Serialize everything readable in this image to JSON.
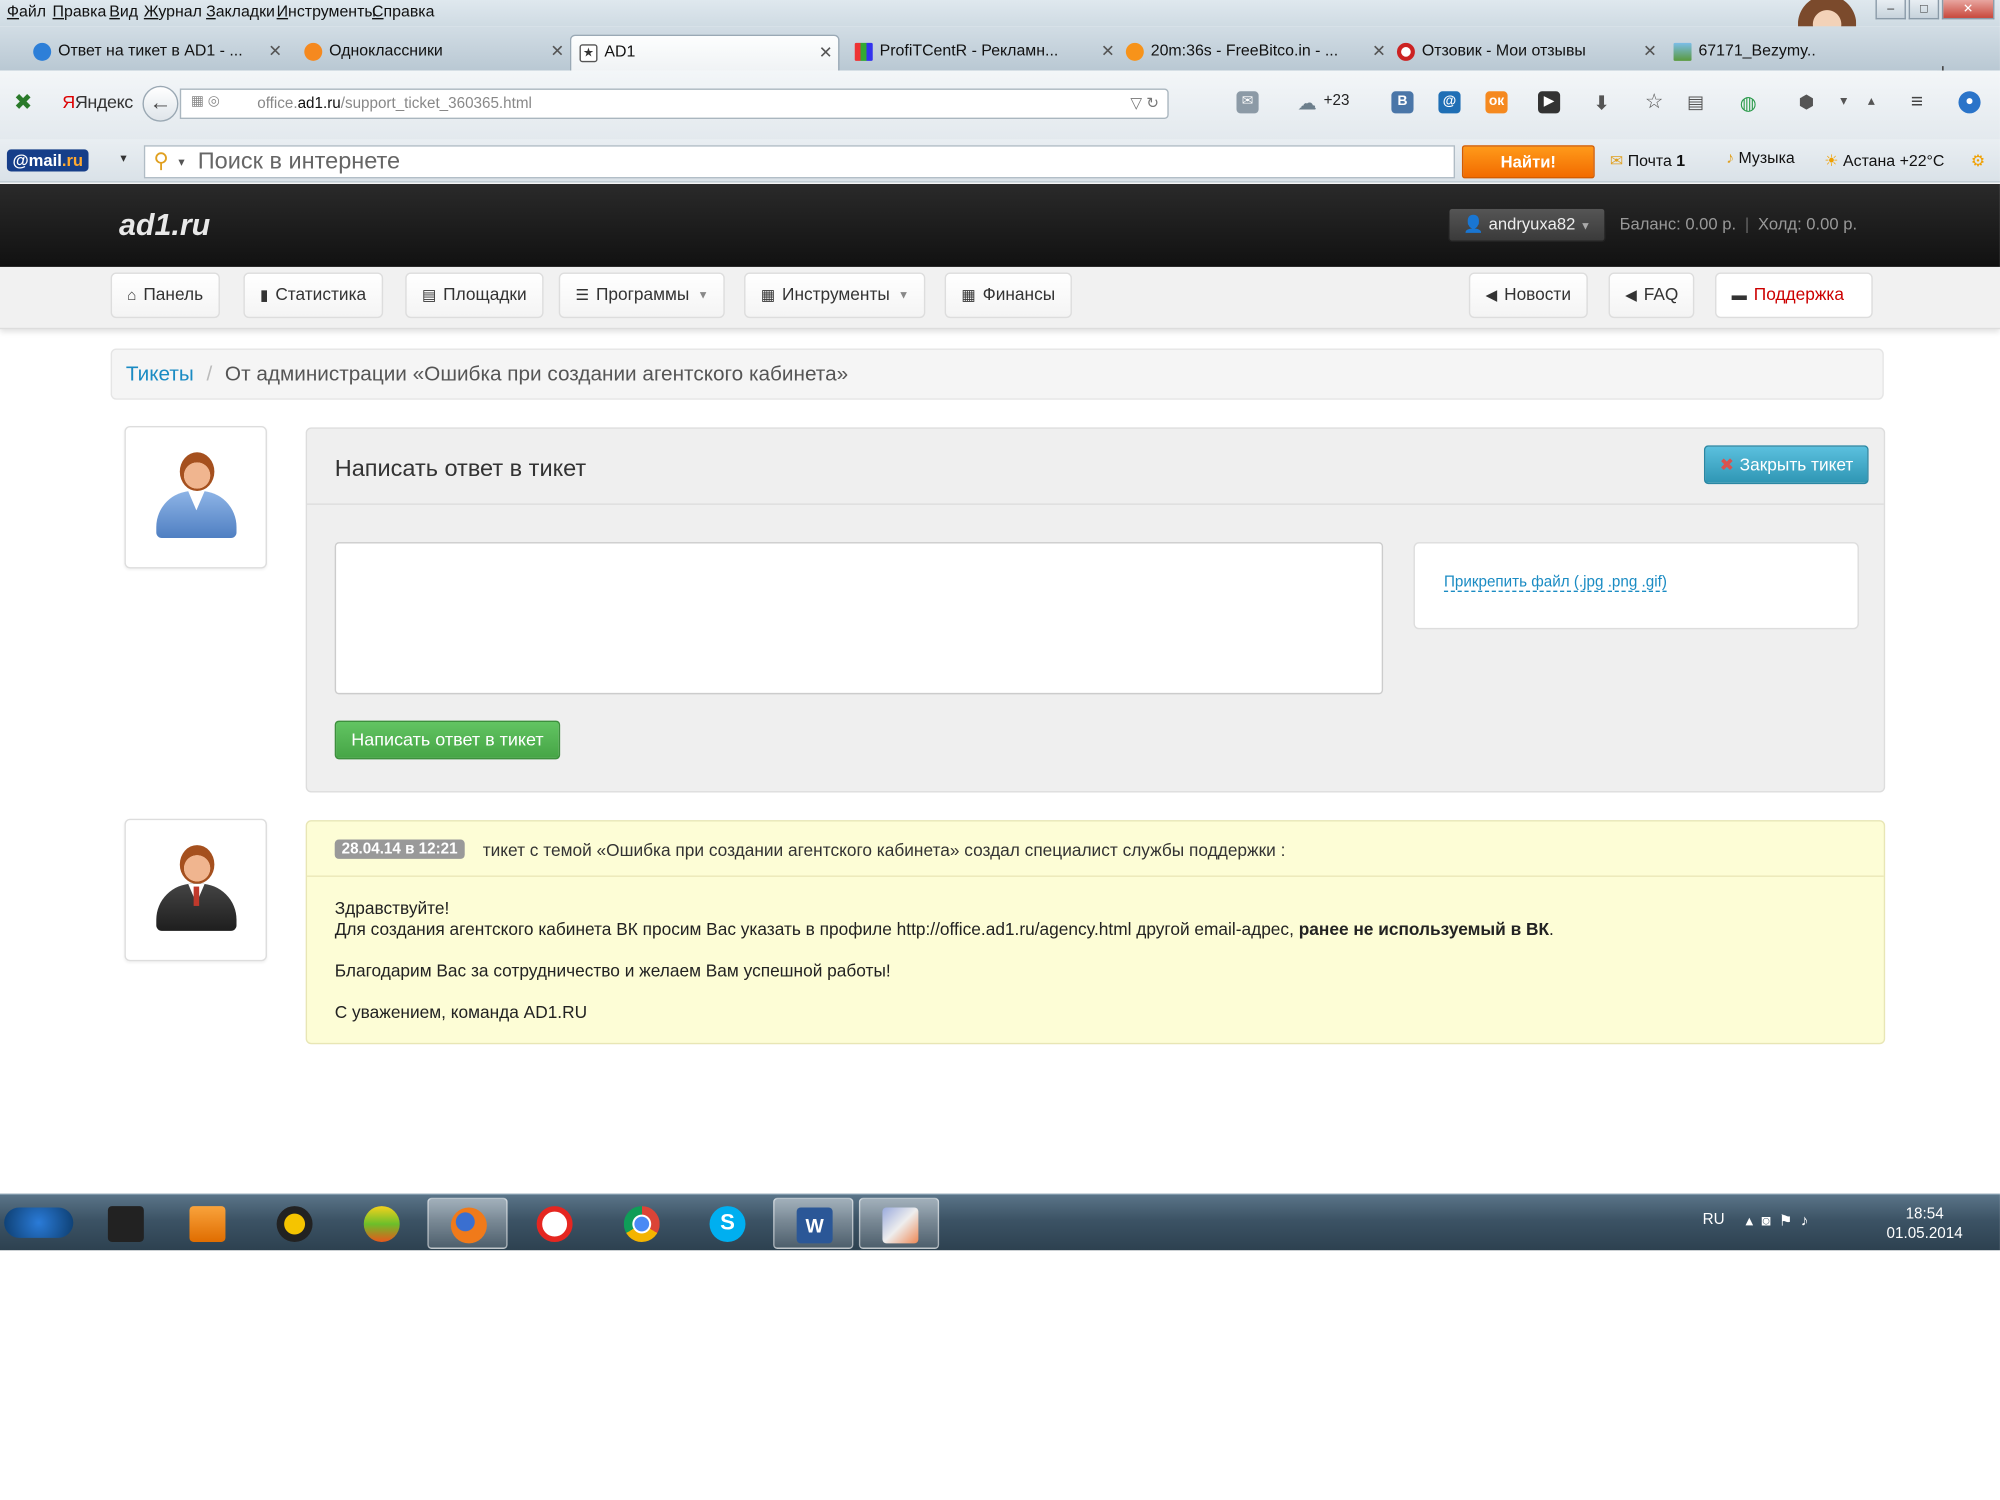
{
  "browser": {
    "menu": [
      "Файл",
      "Правка",
      "Вид",
      "Журнал",
      "Закладки",
      "Инструменты",
      "Справка"
    ],
    "tabs": [
      {
        "title": "Ответ на тикет в AD1 - ...",
        "active": false
      },
      {
        "title": "Одноклассники",
        "active": false
      },
      {
        "title": "AD1",
        "active": true
      },
      {
        "title": "ProfiTCentR - Рекламн...",
        "active": false
      },
      {
        "title": "20m:36s - FreeBitco.in - ...",
        "active": false
      },
      {
        "title": "Отзовик - Мои отзывы",
        "active": false
      },
      {
        "title": "67171_Bezymy..",
        "active": false
      }
    ],
    "yandex_label": "Яндекс",
    "url_prefix": "office.",
    "url_domain": "ad1.ru",
    "url_path": "/support_ticket_360365.html",
    "weather_nav": "+23",
    "mailru_label_a": "@mail",
    "mailru_label_b": ".ru",
    "search_placeholder": "Поиск в интернете",
    "search_button": "Найти!",
    "mail_label": "Почта",
    "mail_count": "1",
    "music_label": "Музыка",
    "weather_label": "Астана +22°C"
  },
  "site": {
    "logo": "ad1.ru",
    "username": "andryuxa82",
    "balance": "Баланс: 0.00 р.",
    "hold": "Холд: 0.00 р.",
    "nav_left": [
      {
        "label": "Панель",
        "icon": "home-icon",
        "caret": false
      },
      {
        "label": "Статистика",
        "icon": "bar-chart-icon",
        "caret": false
      },
      {
        "label": "Площадки",
        "icon": "list-icon",
        "caret": false
      },
      {
        "label": "Программы",
        "icon": "stack-icon",
        "caret": true
      },
      {
        "label": "Инструменты",
        "icon": "grid-icon",
        "caret": true
      },
      {
        "label": "Финансы",
        "icon": "calendar-icon",
        "caret": false
      }
    ],
    "nav_right": [
      {
        "label": "Новости",
        "icon": "megaphone-icon"
      },
      {
        "label": "FAQ",
        "icon": "megaphone-icon"
      },
      {
        "label": "Поддержка",
        "icon": "comment-icon"
      }
    ],
    "breadcrumb": {
      "link": "Тикеты",
      "separator": "/",
      "current": "От администрации «Ошибка при создании агентского кабинета»"
    },
    "reply": {
      "title": "Написать ответ в тикет",
      "close_button": "Закрыть тикет",
      "attach_link": "Прикрепить файл (.jpg .png .gif)",
      "submit_button": "Написать ответ в тикет",
      "textarea_value": ""
    },
    "message": {
      "date": "28.04.14 в 12:21",
      "subject": "тикет с темой «Ошибка при создании агентского кабинета» создал специалист службы поддержки :",
      "greeting": "Здравствуйте!",
      "line1_start": "Для создания агентского кабинета ВК просим Вас указать в профиле http://office.ad1.ru/agency.html другой email-адрес,",
      "line1_bold": "ранее не используемый в ВК",
      "line1_end": ".",
      "thanks": "Благодарим Вас за сотрудничество и желаем Вам успешной работы!",
      "signature": "С уважением, команда AD1.RU"
    }
  },
  "taskbar": {
    "lang": "RU",
    "time": "18:54",
    "date": "01.05.2014"
  },
  "colors": {
    "link": "#1a8bc3",
    "support_red": "#cc0000",
    "success_green": "#51a351",
    "info_blue": "#49afcd",
    "message_bg": "#fdfdd6"
  }
}
